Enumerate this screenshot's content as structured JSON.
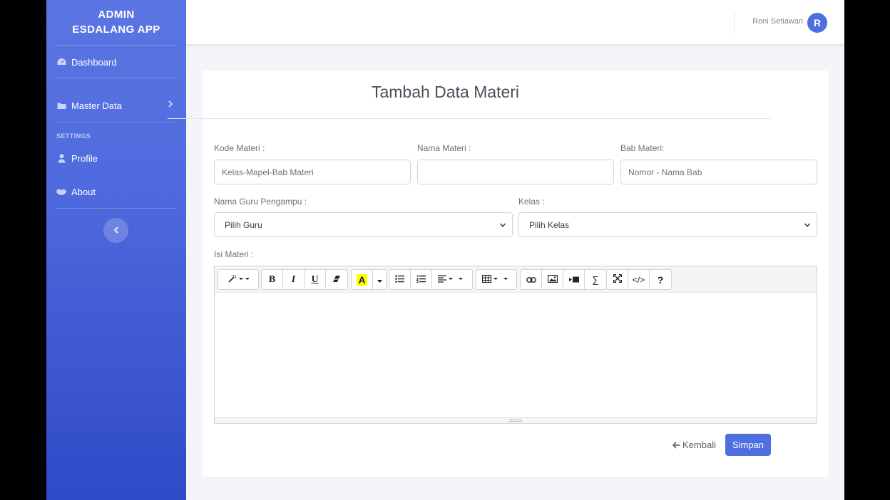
{
  "brand": {
    "line1": "ADMIN",
    "line2": "ESDALANG APP"
  },
  "sidebar": {
    "items": [
      {
        "label": "Dashboard",
        "icon": "dashboard-icon"
      },
      {
        "label": "Master Data",
        "icon": "folder-icon"
      },
      {
        "label": "Profile",
        "icon": "user-icon"
      },
      {
        "label": "About",
        "icon": "handshake-icon"
      }
    ],
    "section_settings": "SETTINGS",
    "toggle_icon": "chevron-left-icon"
  },
  "topbar": {
    "user_name": "Roni Setiawan",
    "avatar_initial": "R"
  },
  "form": {
    "title": "Tambah Data Materi",
    "kode_label": "Kode Materi :",
    "kode_placeholder": "Kelas-Mapel-Bab Materi",
    "nama_label": "Nama Materi :",
    "nama_value": "",
    "bab_label": "Bab Materi:",
    "bab_placeholder": "Nomor - Nama Bab",
    "guru_label": "Nama Guru Pengampu :",
    "guru_selected": "Pilih Guru",
    "kelas_label": "Kelas :",
    "kelas_selected": "Pilih Kelas",
    "isi_label": "Isi Materi :",
    "back_label": "Kembali",
    "save_label": "Simpan"
  },
  "editor_toolbar": {
    "bold": "B",
    "italic": "I",
    "underline": "U",
    "highlight": "A",
    "sigma": "∑",
    "code": "</>",
    "help": "?"
  },
  "colors": {
    "primary": "#4e6fe0",
    "sidebar_top": "#5b76e3",
    "sidebar_bottom": "#2f4ac7"
  }
}
